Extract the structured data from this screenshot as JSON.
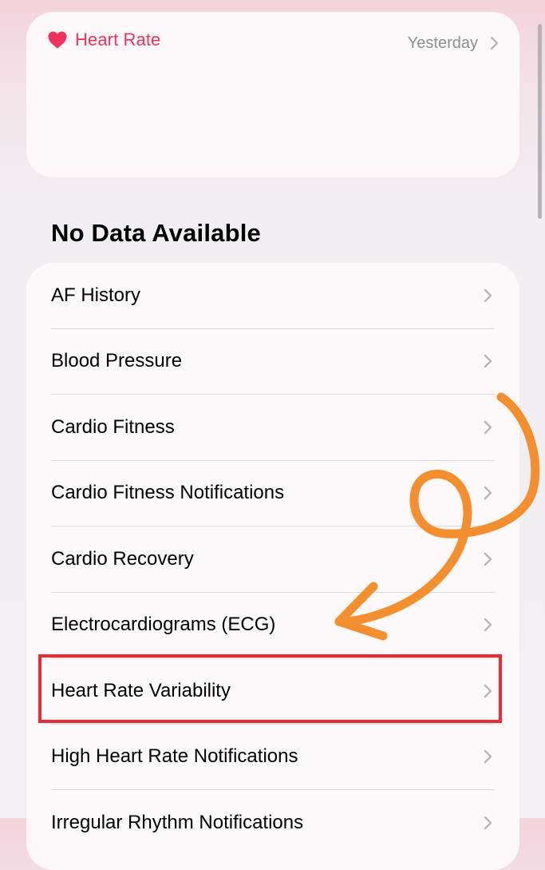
{
  "heart_rate_card": {
    "title": "Heart Rate",
    "date_label": "Yesterday",
    "accent_color": "#f2305c",
    "icon": "heart-icon"
  },
  "section": {
    "title": "No Data Available"
  },
  "list": {
    "chevron_icon": "chevron-right-icon",
    "items": [
      {
        "label": "AF History"
      },
      {
        "label": "Blood Pressure"
      },
      {
        "label": "Cardio Fitness"
      },
      {
        "label": "Cardio Fitness Notifications"
      },
      {
        "label": "Cardio Recovery"
      },
      {
        "label": "Electrocardiograms (ECG)"
      },
      {
        "label": "Heart Rate Variability",
        "highlighted": true
      },
      {
        "label": "High Heart Rate Notifications"
      },
      {
        "label": "Irregular Rhythm Notifications"
      }
    ]
  },
  "annotations": {
    "highlight_color": "#ef2b31",
    "arrow_color": "#f48f2f"
  }
}
